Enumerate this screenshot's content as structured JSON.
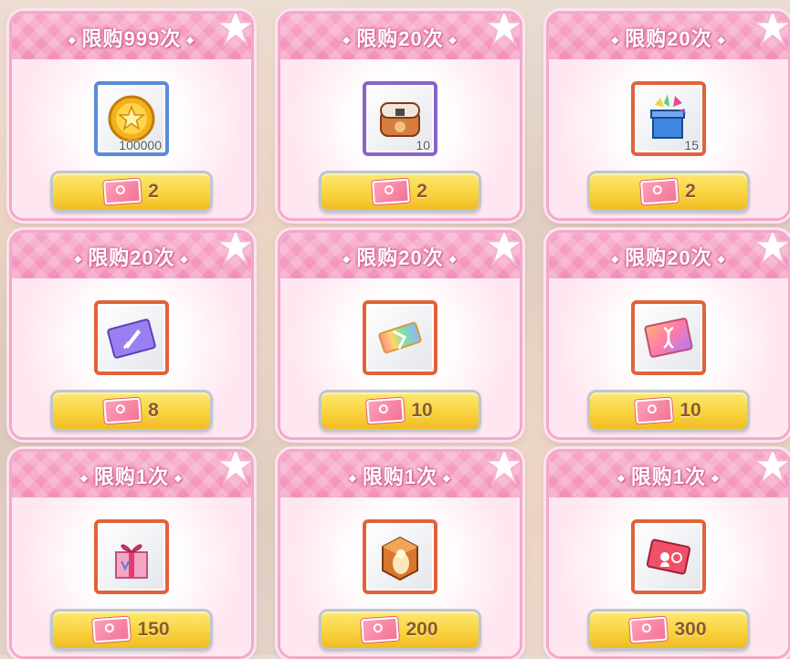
{
  "colors": {
    "header_pink": "#f38fb9",
    "button_yellow": "#f8d13b",
    "rarity_blue": "#5b8ad9",
    "rarity_purple": "#8a63c8",
    "rarity_orange": "#e2613b"
  },
  "currency_icon": "pink-ticket-icon",
  "items": [
    {
      "limit": "限购999次",
      "icon": "gold-coin-icon",
      "frame": "blue",
      "quantity": "100000",
      "price": "2"
    },
    {
      "limit": "限购20次",
      "icon": "treasure-box-icon",
      "frame": "purple",
      "quantity": "10",
      "price": "2"
    },
    {
      "limit": "限购20次",
      "icon": "gift-box-icon",
      "frame": "orange",
      "quantity": "15",
      "price": "2"
    },
    {
      "limit": "限购20次",
      "icon": "sword-card-icon",
      "frame": "orange",
      "quantity": "",
      "price": "8"
    },
    {
      "limit": "限购20次",
      "icon": "rainbow-ticket-icon",
      "frame": "orange",
      "quantity": "",
      "price": "10"
    },
    {
      "limit": "限购20次",
      "icon": "dna-card-icon",
      "frame": "orange",
      "quantity": "",
      "price": "10"
    },
    {
      "limit": "限购1次",
      "icon": "present-box-icon",
      "frame": "orange",
      "quantity": "",
      "price": "150"
    },
    {
      "limit": "限购1次",
      "icon": "silhouette-cube-icon",
      "frame": "orange",
      "quantity": "",
      "price": "200"
    },
    {
      "limit": "限购1次",
      "icon": "red-ticket-icon",
      "frame": "orange",
      "quantity": "",
      "price": "300"
    }
  ]
}
